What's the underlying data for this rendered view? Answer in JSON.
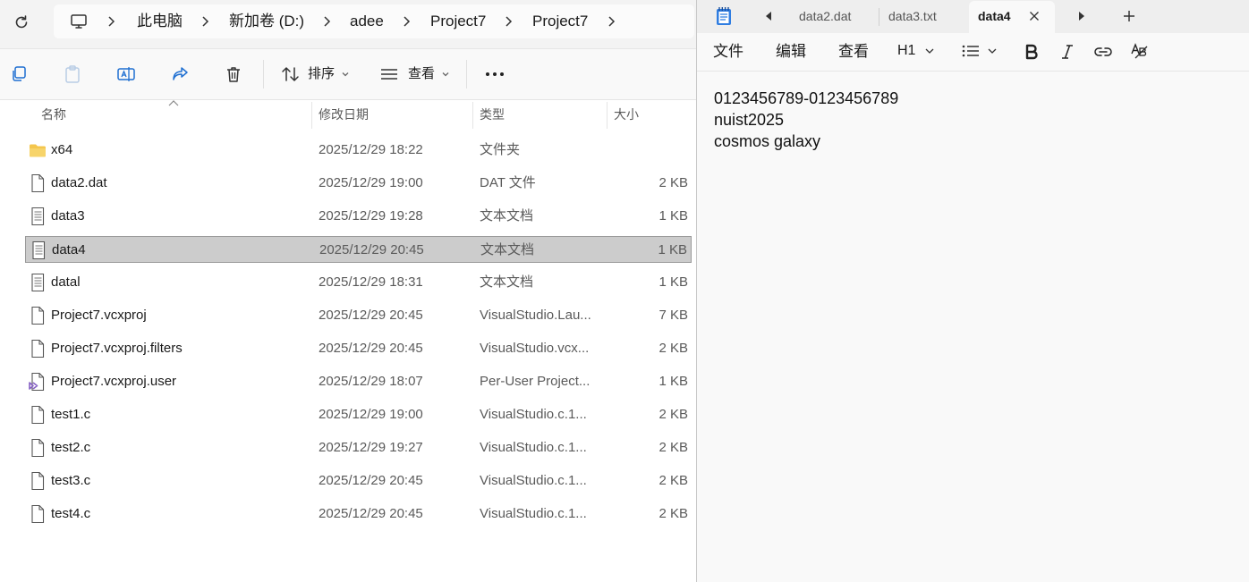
{
  "explorer": {
    "breadcrumb": [
      "此电脑",
      "新加卷 (D:)",
      "adee",
      "Project7",
      "Project7"
    ],
    "toolbar": {
      "sort_label": "排序",
      "view_label": "查看"
    },
    "columns": {
      "name": "名称",
      "date": "修改日期",
      "type": "类型",
      "size": "大小"
    },
    "files": [
      {
        "name": "x64",
        "date": "2025/12/29 18:22",
        "type": "文件夹",
        "size": "",
        "icon": "folder-icon"
      },
      {
        "name": "data2.dat",
        "date": "2025/12/29 19:00",
        "type": "DAT 文件",
        "size": "2 KB",
        "icon": "file-icon"
      },
      {
        "name": "data3",
        "date": "2025/12/29 19:28",
        "type": "文本文档",
        "size": "1 KB",
        "icon": "text-file-icon"
      },
      {
        "name": "data4",
        "date": "2025/12/29 20:45",
        "type": "文本文档",
        "size": "1 KB",
        "icon": "text-file-icon",
        "selected": true
      },
      {
        "name": "datal",
        "date": "2025/12/29 18:31",
        "type": "文本文档",
        "size": "1 KB",
        "icon": "text-file-icon"
      },
      {
        "name": "Project7.vcxproj",
        "date": "2025/12/29 20:45",
        "type": "VisualStudio.Lau...",
        "size": "7 KB",
        "icon": "file-icon"
      },
      {
        "name": "Project7.vcxproj.filters",
        "date": "2025/12/29 20:45",
        "type": "VisualStudio.vcx...",
        "size": "2 KB",
        "icon": "file-icon"
      },
      {
        "name": "Project7.vcxproj.user",
        "date": "2025/12/29 18:07",
        "type": "Per-User Project...",
        "size": "1 KB",
        "icon": "visual-studio-file-icon"
      },
      {
        "name": "test1.c",
        "date": "2025/12/29 19:00",
        "type": "VisualStudio.c.1...",
        "size": "2 KB",
        "icon": "file-icon"
      },
      {
        "name": "test2.c",
        "date": "2025/12/29 19:27",
        "type": "VisualStudio.c.1...",
        "size": "2 KB",
        "icon": "file-icon"
      },
      {
        "name": "test3.c",
        "date": "2025/12/29 20:45",
        "type": "VisualStudio.c.1...",
        "size": "2 KB",
        "icon": "file-icon"
      },
      {
        "name": "test4.c",
        "date": "2025/12/29 20:45",
        "type": "VisualStudio.c.1...",
        "size": "2 KB",
        "icon": "file-icon"
      }
    ]
  },
  "notepad": {
    "tabs": [
      "data2.dat",
      "data3.txt",
      "data4"
    ],
    "active_tab": "data4",
    "menu": {
      "file": "文件",
      "edit": "编辑",
      "view": "查看",
      "heading": "H1"
    },
    "content": [
      "0123456789-0123456789",
      "nuist2025",
      "cosmos galaxy"
    ]
  },
  "colors": {
    "selection": "#cccccc",
    "folder": "#f4c64d",
    "notepad_icon": "#2f7de1",
    "vs_purple": "#8661c5"
  }
}
